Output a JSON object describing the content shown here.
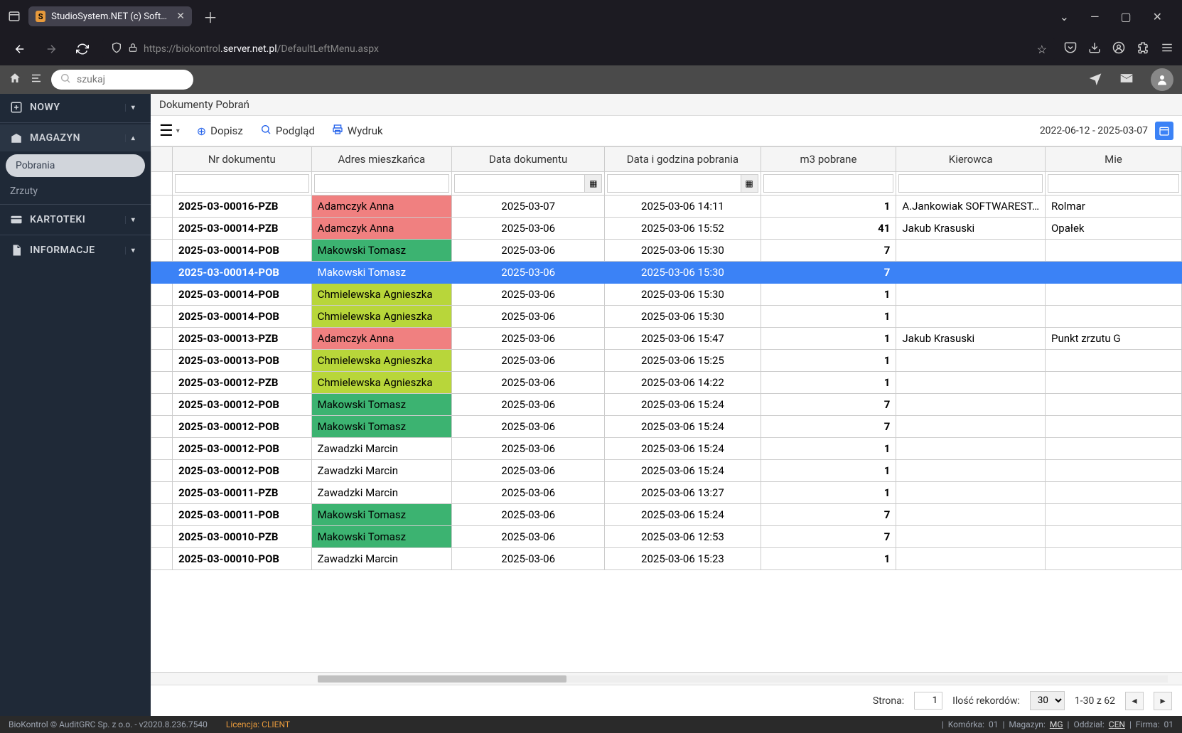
{
  "browser": {
    "tab_title": "StudioSystem.NET (c) SoftwareS",
    "url_prefix": "https://biokontrol",
    "url_highlight": ".server.net.pl",
    "url_suffix": "/DefaultLeftMenu.aspx"
  },
  "topbar": {
    "search_placeholder": "szukaj"
  },
  "sidebar": {
    "nowy": "NOWY",
    "magazyn": "MAGAZYN",
    "pobrania": "Pobrania",
    "zrzuty": "Zrzuty",
    "kartoteki": "KARTOTEKI",
    "informacje": "INFORMACJE"
  },
  "content": {
    "title": "Dokumenty Pobrań",
    "dopisz": "Dopisz",
    "podglad": "Podgląd",
    "wydruk": "Wydruk",
    "date_range": "2022-06-12 - 2025-03-07"
  },
  "columns": {
    "c1": "Nr dokumentu",
    "c2": "Adres mieszkańca",
    "c3": "Data dokumentu",
    "c4": "Data i godzina pobrania",
    "c5": "m3 pobrane",
    "c6": "Kierowca",
    "c7": "Mie"
  },
  "rows": [
    {
      "doc": "2025-03-00016-PZB",
      "addr": "Adamczyk Anna",
      "addrcls": "addr-red",
      "date": "2025-03-07",
      "dt": "2025-03-06 14:11",
      "m3": "1",
      "drv": "A.Jankowiak SOFTWAREST…",
      "loc": "Rolmar"
    },
    {
      "doc": "2025-03-00014-PZB",
      "addr": "Adamczyk Anna",
      "addrcls": "addr-red",
      "date": "2025-03-06",
      "dt": "2025-03-06 15:52",
      "m3": "41",
      "drv": "Jakub Krasuski",
      "loc": "Opałek"
    },
    {
      "doc": "2025-03-00014-POB",
      "addr": "Makowski Tomasz",
      "addrcls": "addr-green",
      "date": "2025-03-06",
      "dt": "2025-03-06 15:30",
      "m3": "7",
      "drv": "",
      "loc": ""
    },
    {
      "doc": "2025-03-00014-POB",
      "addr": "Makowski Tomasz",
      "addrcls": "",
      "date": "2025-03-06",
      "dt": "2025-03-06 15:30",
      "m3": "7",
      "drv": "",
      "loc": "",
      "selected": true
    },
    {
      "doc": "2025-03-00014-POB",
      "addr": "Chmielewska Agnieszka",
      "addrcls": "addr-olive",
      "date": "2025-03-06",
      "dt": "2025-03-06 15:30",
      "m3": "1",
      "drv": "",
      "loc": ""
    },
    {
      "doc": "2025-03-00014-POB",
      "addr": "Chmielewska Agnieszka",
      "addrcls": "addr-olive",
      "date": "2025-03-06",
      "dt": "2025-03-06 15:30",
      "m3": "1",
      "drv": "",
      "loc": ""
    },
    {
      "doc": "2025-03-00013-PZB",
      "addr": "Adamczyk Anna",
      "addrcls": "addr-red",
      "date": "2025-03-06",
      "dt": "2025-03-06 15:47",
      "m3": "1",
      "drv": "Jakub Krasuski",
      "loc": "Punkt zrzutu G"
    },
    {
      "doc": "2025-03-00013-POB",
      "addr": "Chmielewska Agnieszka",
      "addrcls": "addr-olive",
      "date": "2025-03-06",
      "dt": "2025-03-06 15:25",
      "m3": "1",
      "drv": "",
      "loc": ""
    },
    {
      "doc": "2025-03-00012-PZB",
      "addr": "Chmielewska Agnieszka",
      "addrcls": "addr-olive",
      "date": "2025-03-06",
      "dt": "2025-03-06 14:22",
      "m3": "1",
      "drv": "",
      "loc": ""
    },
    {
      "doc": "2025-03-00012-POB",
      "addr": "Makowski Tomasz",
      "addrcls": "addr-green",
      "date": "2025-03-06",
      "dt": "2025-03-06 15:24",
      "m3": "7",
      "drv": "",
      "loc": ""
    },
    {
      "doc": "2025-03-00012-POB",
      "addr": "Makowski Tomasz",
      "addrcls": "addr-green",
      "date": "2025-03-06",
      "dt": "2025-03-06 15:24",
      "m3": "7",
      "drv": "",
      "loc": ""
    },
    {
      "doc": "2025-03-00012-POB",
      "addr": "Zawadzki Marcin",
      "addrcls": "",
      "date": "2025-03-06",
      "dt": "2025-03-06 15:24",
      "m3": "1",
      "drv": "",
      "loc": ""
    },
    {
      "doc": "2025-03-00012-POB",
      "addr": "Zawadzki Marcin",
      "addrcls": "",
      "date": "2025-03-06",
      "dt": "2025-03-06 15:24",
      "m3": "1",
      "drv": "",
      "loc": ""
    },
    {
      "doc": "2025-03-00011-PZB",
      "addr": "Zawadzki Marcin",
      "addrcls": "",
      "date": "2025-03-06",
      "dt": "2025-03-06 13:27",
      "m3": "1",
      "drv": "",
      "loc": ""
    },
    {
      "doc": "2025-03-00011-POB",
      "addr": "Makowski Tomasz",
      "addrcls": "addr-green",
      "date": "2025-03-06",
      "dt": "2025-03-06 15:24",
      "m3": "7",
      "drv": "",
      "loc": ""
    },
    {
      "doc": "2025-03-00010-PZB",
      "addr": "Makowski Tomasz",
      "addrcls": "addr-green",
      "date": "2025-03-06",
      "dt": "2025-03-06 12:53",
      "m3": "7",
      "drv": "",
      "loc": ""
    },
    {
      "doc": "2025-03-00010-POB",
      "addr": "Zawadzki Marcin",
      "addrcls": "",
      "date": "2025-03-06",
      "dt": "2025-03-06 15:23",
      "m3": "1",
      "drv": "",
      "loc": ""
    }
  ],
  "pager": {
    "strona_label": "Strona:",
    "strona_val": "1",
    "ilosc_label": "Ilość rekordów:",
    "ilosc_val": "30",
    "range": "1-30 z 62"
  },
  "footer": {
    "left1": "BioKontrol © AuditGRC Sp. z o.o. - v2020.8.236.7540",
    "lic_label": "Licencja:",
    "lic_val": "CLIENT",
    "komorka": "Komórka:",
    "komorka_v": "01",
    "magazyn": "Magazyn:",
    "magazyn_v": "MG",
    "oddzial": "Oddział:",
    "oddzial_v": "CEN",
    "firma": "Firma:",
    "firma_v": "01"
  }
}
